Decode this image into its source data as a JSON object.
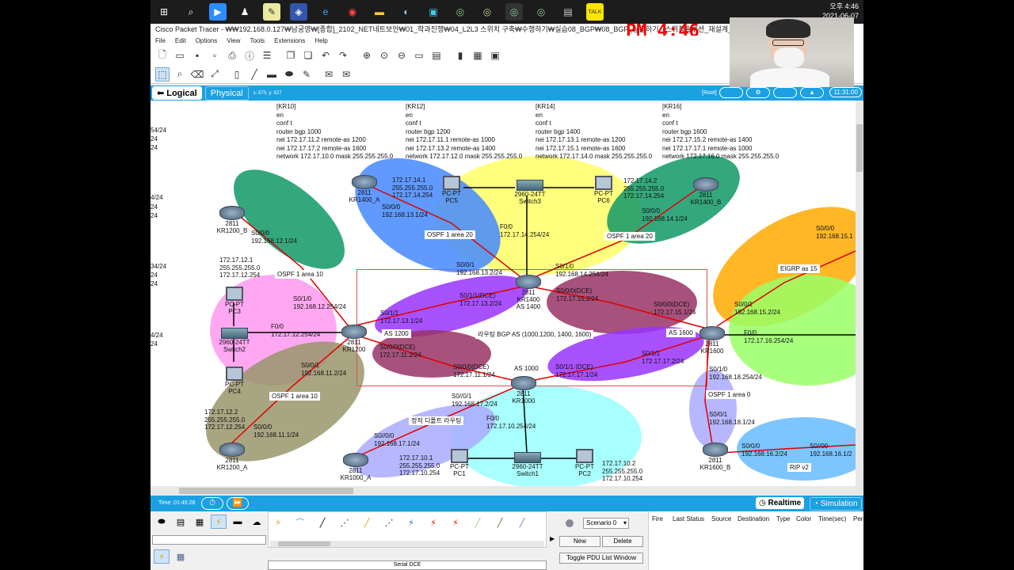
{
  "taskbar": {
    "time": "오후 4:46",
    "date": "2021-06-07"
  },
  "window": {
    "title": "Cisco Packet Tracer - ₩₩192.168.0.127₩남궁영₩[종합]_2102_NET네트보안₩01_학과진행₩04_L2L3 스위치 구축₩수행하기₩실습08_BGP₩08_BGP_실습하기_(스위칭솔루션_재설계_04_C)_교육",
    "pm_badge": "PM 4:46"
  },
  "menu": [
    "File",
    "Edit",
    "Options",
    "View",
    "Tools",
    "Extensions",
    "Help"
  ],
  "modebar": {
    "logical": "Logical",
    "physical": "Physical",
    "coords": "x: 570, y: 527",
    "root": "[Root]",
    "clock": "11:31:00"
  },
  "configs": [
    {
      "text": "[KR10]\nen\nconf t\nrouter bgp 1000\nnei 172.17.11.2 remote-as 1200\nnei 172.17.17.2 remote-as 1600\nnetwork 172.17.10.0 mask 255.255.255.0"
    },
    {
      "text": "[KR12]\nen\nconf t\nrouter bgp 1200\nnei 172.17.11.1 remote-as 1000\nnei 172.17.13.2 remote-as 1400\nnetwork 172.17.12.0 mask 255.255.255.0"
    },
    {
      "text": "[KR14]\nen\nconf t\nrouter bgp 1400\nnei 172.17.13.1 remote-as 1200\nnei 172.17.15.1 remote-as 1600\nnetwork 172.17.14.0 mask 255.255.255.0"
    },
    {
      "text": "[KR16]\nen\nconf t\nrouter bgp 1600\nnei 172.17.15.2 remote-as 1400\nnei 172.17.17.1 remote-as 1000\nnetwork 172.17.16.0 mask 255.255.255.0"
    }
  ],
  "left_fragments": [
    "54/24",
    "24",
    "24",
    "4/24",
    "24",
    "24",
    "34/24",
    "24",
    "24",
    "4/24",
    "24"
  ],
  "devices": {
    "kr1400_a": {
      "model": "2811",
      "name": "KR1400_A"
    },
    "kr1400_b": {
      "model": "2811",
      "name": "KR1400_B"
    },
    "kr1200_b": {
      "model": "2811",
      "name": "KR1200_B"
    },
    "kr1200": {
      "model": "2811",
      "name": "KR1200"
    },
    "kr1200_a": {
      "model": "2811",
      "name": "KR1200_A"
    },
    "kr1400": {
      "model": "2811",
      "name": "KR1400",
      "as": "AS 1400"
    },
    "kr1000": {
      "model": "2811",
      "name": "KR1000"
    },
    "kr1000_a": {
      "model": "2811",
      "name": "KR1000_A"
    },
    "kr1600": {
      "model": "2811",
      "name": "KR1600"
    },
    "kr1600_b": {
      "model": "2811",
      "name": "KR1600_B"
    },
    "pc5": {
      "model": "PC-PT",
      "name": "PC5"
    },
    "pc6": {
      "model": "PC-PT",
      "name": "PC6"
    },
    "pc3": {
      "model": "PC-PT",
      "name": "PC3"
    },
    "pc4": {
      "model": "PC-PT",
      "name": "PC4"
    },
    "pc1": {
      "model": "PC-PT",
      "name": "PC1"
    },
    "pc2": {
      "model": "PC-PT",
      "name": "PC2"
    },
    "switch3": {
      "model": "2960-24TT",
      "name": "Switch3"
    },
    "switch2": {
      "model": "2960-24TT",
      "name": "Switch2"
    },
    "switch1": {
      "model": "2960-24TT",
      "name": "Switch1"
    }
  },
  "labels": {
    "pc5_ip": "172.17.14.1\n255.255.255.0\n172.17.14.254",
    "pc6_ip": "172.17.14.2\n255.255.255.0\n172.17.14.254",
    "kr1400a_s000": "S0/0/0\n192.168.13.1/24",
    "kr1400b_s000": "S0/0/0\n192.168.14.1/24",
    "kr1400_f00": "F0/0\n172.17.14.254/24",
    "kr1200b_s000": "S0/0/0\n192.168.12.1/24",
    "pc3_ip": "172.17.12.1\n255.255.255.0\n172.17.12.254",
    "kr1200_s010": "S0/1/0\n192.168.12.254/24",
    "kr1200_f00": "F0/0\n172.17.12.254/24",
    "kr1200_s001": "S0/0/1\n192.168.11.2/24",
    "pc4_ip": "172.17.12.2\n255.255.255.0\n172.17.12.254",
    "kr1200a_s000": "S0/0/0\n192.168.11.1/24",
    "kr1400_s001": "S0/0/1\n192.168.13.2/24",
    "kr1400_s010": "S0/1/0\n192.168.14.254/24",
    "kr1400_s011": "S0/1/1(DCE)\n172.17.13.2/24",
    "kr1400_s000": "S0/0/0(DCE)\n172.17.15.2/24",
    "kr1200_s011": "S0/1/1\n172.17.13.1/24",
    "kr1200_s000": "S0/0/0(DCE)\n172.17.11.2/24",
    "as1200": "AS 1200",
    "bgp_title": "라우팅 BGP AS (1000,1200, 1400, 1600)",
    "kr1000_s000": "S0/0/0(DCE)\n172.17.11.1/24",
    "as1000": "AS 1000",
    "kr1000_s011": "S0/1/1 (DCE)\n172.17.17.1/24",
    "kr1600_s001_bgp": "S0/1/1\n172.17.17.2/24",
    "as1600": "AS 1600",
    "kr1600_s000": "S0/0/0(DCE)\n172.17.15.1/24",
    "kr1000_s001": "S0//0/1\n192.168.17.2/24",
    "static_default": "정적 디폴트 라우팅",
    "kr1000_f00": "F0/0\n172.17.10.254/24",
    "kr1000a_s000": "S0//0/0\n192.168.17.1/24",
    "pc1_ip": "172.17.10.1\n255.255.255.0\n172.17.10.254",
    "pc2_ip": "172.17.10.2\n255.255.255.0\n172.17.10.254",
    "kr1600_s001": "S0/0/1\n192.168.15.2/24",
    "kr1600_f00": "F0/0\n172.17.16.254/24",
    "kr1600_s010": "S0/1/0\n192.168.18.254/24",
    "ospf_area0": "OSPF 1 area 0",
    "kr1600b_s001": "S0/0/1\n192.168.18.1/24",
    "kr1600b_s000": "S0/0/0\n192.168.16.2/24",
    "ripv2_s00": "S0//00\n192.168.16.1/2",
    "ripv2": "RIP v2",
    "eigrp": "EIGRP as 15",
    "eigrp_s000": "S0/0/0\n192.168.15.1",
    "ospf20_left": "OSPF 1 area 20",
    "ospf20_right": "OSPF 1 area 20",
    "ospf10_top": "OSPF 1 area 10",
    "ospf10_bottom": "OSPF 1 area 10"
  },
  "sim": {
    "time": "Time: 01:45:28",
    "realtime": "Realtime",
    "simulation": "Simulation"
  },
  "bottom": {
    "serial_label": "Serial DCE",
    "scenario": "Scenario 0",
    "new": "New",
    "delete": "Delete",
    "toggle": "Toggle PDU List Window",
    "pdu_headers": [
      "Fire",
      "Last Status",
      "Source",
      "Destination",
      "Type",
      "Color",
      "Time(sec)",
      "Per"
    ]
  },
  "colors": {
    "accent": "#1ba1e2",
    "ospf20": "#ffff66",
    "ospf10_green": "#119966",
    "pink": "#ff99ee",
    "purple": "#9933ff",
    "maroon": "#993366",
    "tan": "#99956b",
    "cyan": "#99ffff",
    "lavender": "#aaaaff",
    "orange": "#ffaa00",
    "lightgreen": "#99ff66",
    "skyblue": "#66bbff",
    "red_link": "#e00000"
  }
}
